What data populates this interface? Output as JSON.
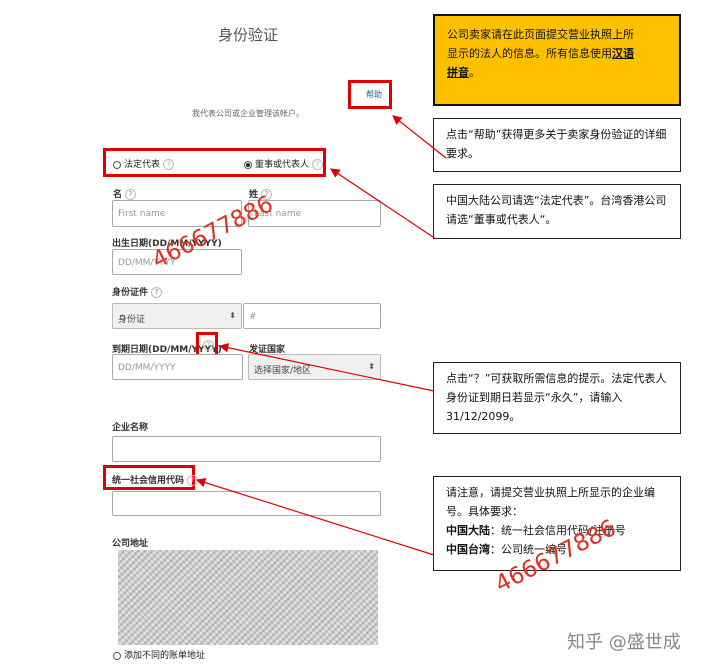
{
  "page": {
    "title": "身份验证",
    "subtitle": "我代表公司或企业管理该帐户。",
    "help_link": "帮助"
  },
  "role": {
    "legal_rep": "法定代表",
    "director": "董事或代表人",
    "selected": "director"
  },
  "name": {
    "first_label": "名",
    "first_placeholder": "First name",
    "last_label": "姓",
    "last_placeholder": "Last name"
  },
  "dob": {
    "label": "出生日期(DD/MM/YYYY)",
    "placeholder": "DD/MM/YYYY"
  },
  "id_doc": {
    "label": "身份证件",
    "type_value": "身份证",
    "number_placeholder": "#"
  },
  "expiry": {
    "label": "到期日期(DD/MM/YYYY)",
    "placeholder": "DD/MM/YYYY"
  },
  "issuer": {
    "label": "发证国家",
    "value": "选择国家/地区"
  },
  "company": {
    "name_label": "企业名称",
    "credit_code_label": "统一社会信用代码",
    "address_label": "公司地址"
  },
  "add_billing": "添加不同的账单地址",
  "notes": {
    "top_line1": "公司卖家请在此页面提交营业执照上所",
    "top_line2": "显示的法人的信息。所有信息使用",
    "top_bold1": "汉语",
    "top_bold2": "拼音",
    "top_end": "。",
    "help_text": "点击“帮助”获得更多关于卖家身份验证的详细要求。",
    "role_text": "中国大陆公司请选“法定代表”。台湾香港公司请选“董事或代表人“。",
    "question_text": "点击“？”可获取所需信息的提示。法定代表人身份证到期日若显示“永久”，请输入31/12/2099。",
    "code_intro": "请注意，请提交营业执照上所显示的企业编号。具体要求：",
    "mainland_label": "中国大陆",
    "mainland_text": "：统一社会信用代码/注册号",
    "taiwan_label": "中国台湾",
    "taiwan_text": "：公司统一编号"
  },
  "watermark": {
    "text1": "466677886",
    "text2": "466677886",
    "brand": "知乎 @盛世成"
  },
  "colors": {
    "note_yellow": "#ffc000",
    "highlight_red": "#e00000",
    "link_blue": "#1a5fb4"
  }
}
